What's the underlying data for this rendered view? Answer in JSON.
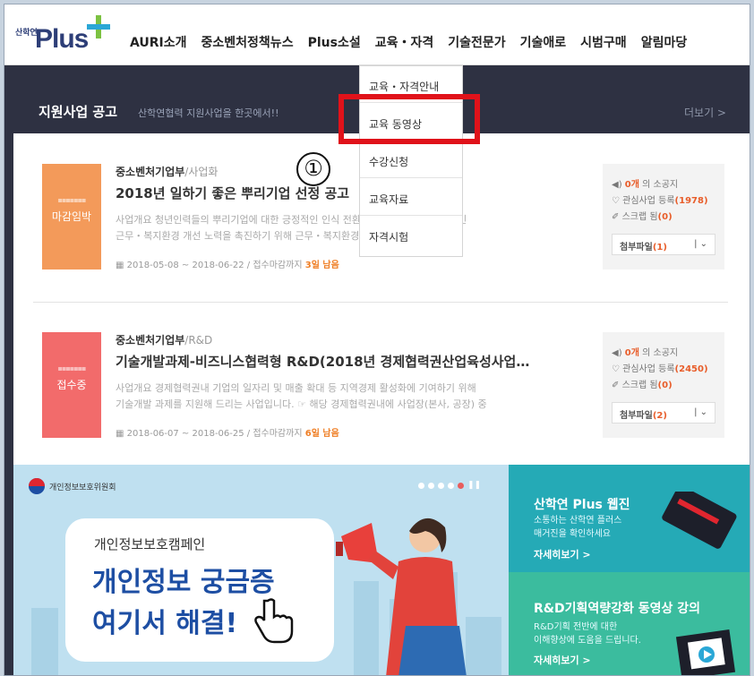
{
  "logo": {
    "small": "산학연",
    "main": "Plus"
  },
  "menu": [
    {
      "label": "AURI소개"
    },
    {
      "label": "중소벤처정책뉴스"
    },
    {
      "label": "Plus소설"
    },
    {
      "label": "교육・자격"
    },
    {
      "label": "기술전문가"
    },
    {
      "label": "기술애로"
    },
    {
      "label": "시범구매"
    },
    {
      "label": "알림마당"
    }
  ],
  "dropdown": [
    {
      "label": "교육・자격안내"
    },
    {
      "label": "교육 동영상"
    },
    {
      "label": "수강신청"
    },
    {
      "label": "교육자료"
    },
    {
      "label": "자격시험"
    }
  ],
  "annotation": {
    "number": "①"
  },
  "notice": {
    "title": "지원사업 공고",
    "subtitle": "산학연협력 지원사업을 한곳에서!!",
    "more": "더보기 >"
  },
  "cards": [
    {
      "thumb_label": "마감임박",
      "thumb_color": "#f39a5a",
      "org": "중소벤처기업부",
      "org_sub": "/사업화",
      "title": "2018년 일하기 좋은 뿌리기업 선정 공고",
      "desc1": "사업개요 청년인력들의 뿌리기업에 대한 긍정적인 인식 전환과 뿌리산업계의 자발적인",
      "desc2": "근무・복지환경 개선 노력을 촉진하기 위해 근무・복지환경 등이 우수한",
      "date": "2018-05-08 ~ 2018-06-22 / 접수마감까지",
      "dday": "3일 남음",
      "notice_count": "0개",
      "notice_suffix": " 의 소공지",
      "fav_prefix": "관심사업 등록",
      "fav_count": "(1978)",
      "scrap_prefix": "스크랩 됨",
      "scrap_count": "(0)",
      "attach_prefix": "첨부파일",
      "attach_count": "(1)"
    },
    {
      "thumb_label": "접수중",
      "thumb_color": "#f26b6b",
      "org": "중소벤처기업부",
      "org_sub": "/R&D",
      "title": "기술개발과제-비즈니스협력형 R&D(2018년 경제협력권산업육성사업…",
      "desc1": "사업개요 경제협력권내 기업의 일자리 및 매출 확대 등 지역경제 활성화에 기여하기 위해",
      "desc2": "기술개발 과제를 지원해 드리는 사업입니다. ☞ 해당 경제협력권내에 사업장(본사, 공장) 중",
      "date": "2018-06-07 ~ 2018-06-25 / 접수마감까지",
      "dday": "6일 남음",
      "notice_count": "0개",
      "notice_suffix": " 의 소공지",
      "fav_prefix": "관심사업 등록",
      "fav_count": "(2450)",
      "scrap_prefix": "스크랩 됨",
      "scrap_count": "(0)",
      "attach_prefix": "첨부파일",
      "attach_count": "(2)"
    }
  ],
  "banner_left": {
    "org": "개인정보보호위원회",
    "small": "개인정보보호캠페인",
    "big1": "개인정보 궁금증",
    "big2": "여기서 해결!"
  },
  "banner_right_top": {
    "title": "산학연 Plus 웹진",
    "sub1": "소통하는 산학연 플러스",
    "sub2": "매거진을 확인하세요",
    "link": "자세히보기 >"
  },
  "banner_right_bot": {
    "title": "R&D기획역량강화 동영상 강의",
    "sub1": "R&D기획 전반에 대한",
    "sub2": "이해향상에 도움을 드립니다.",
    "link": "자세히보기 >"
  },
  "colors": {
    "nav_bg": "#ffffff",
    "dark_bar": "#2e3142",
    "highlight": "#e0121a",
    "accent": "#e85d2a"
  }
}
